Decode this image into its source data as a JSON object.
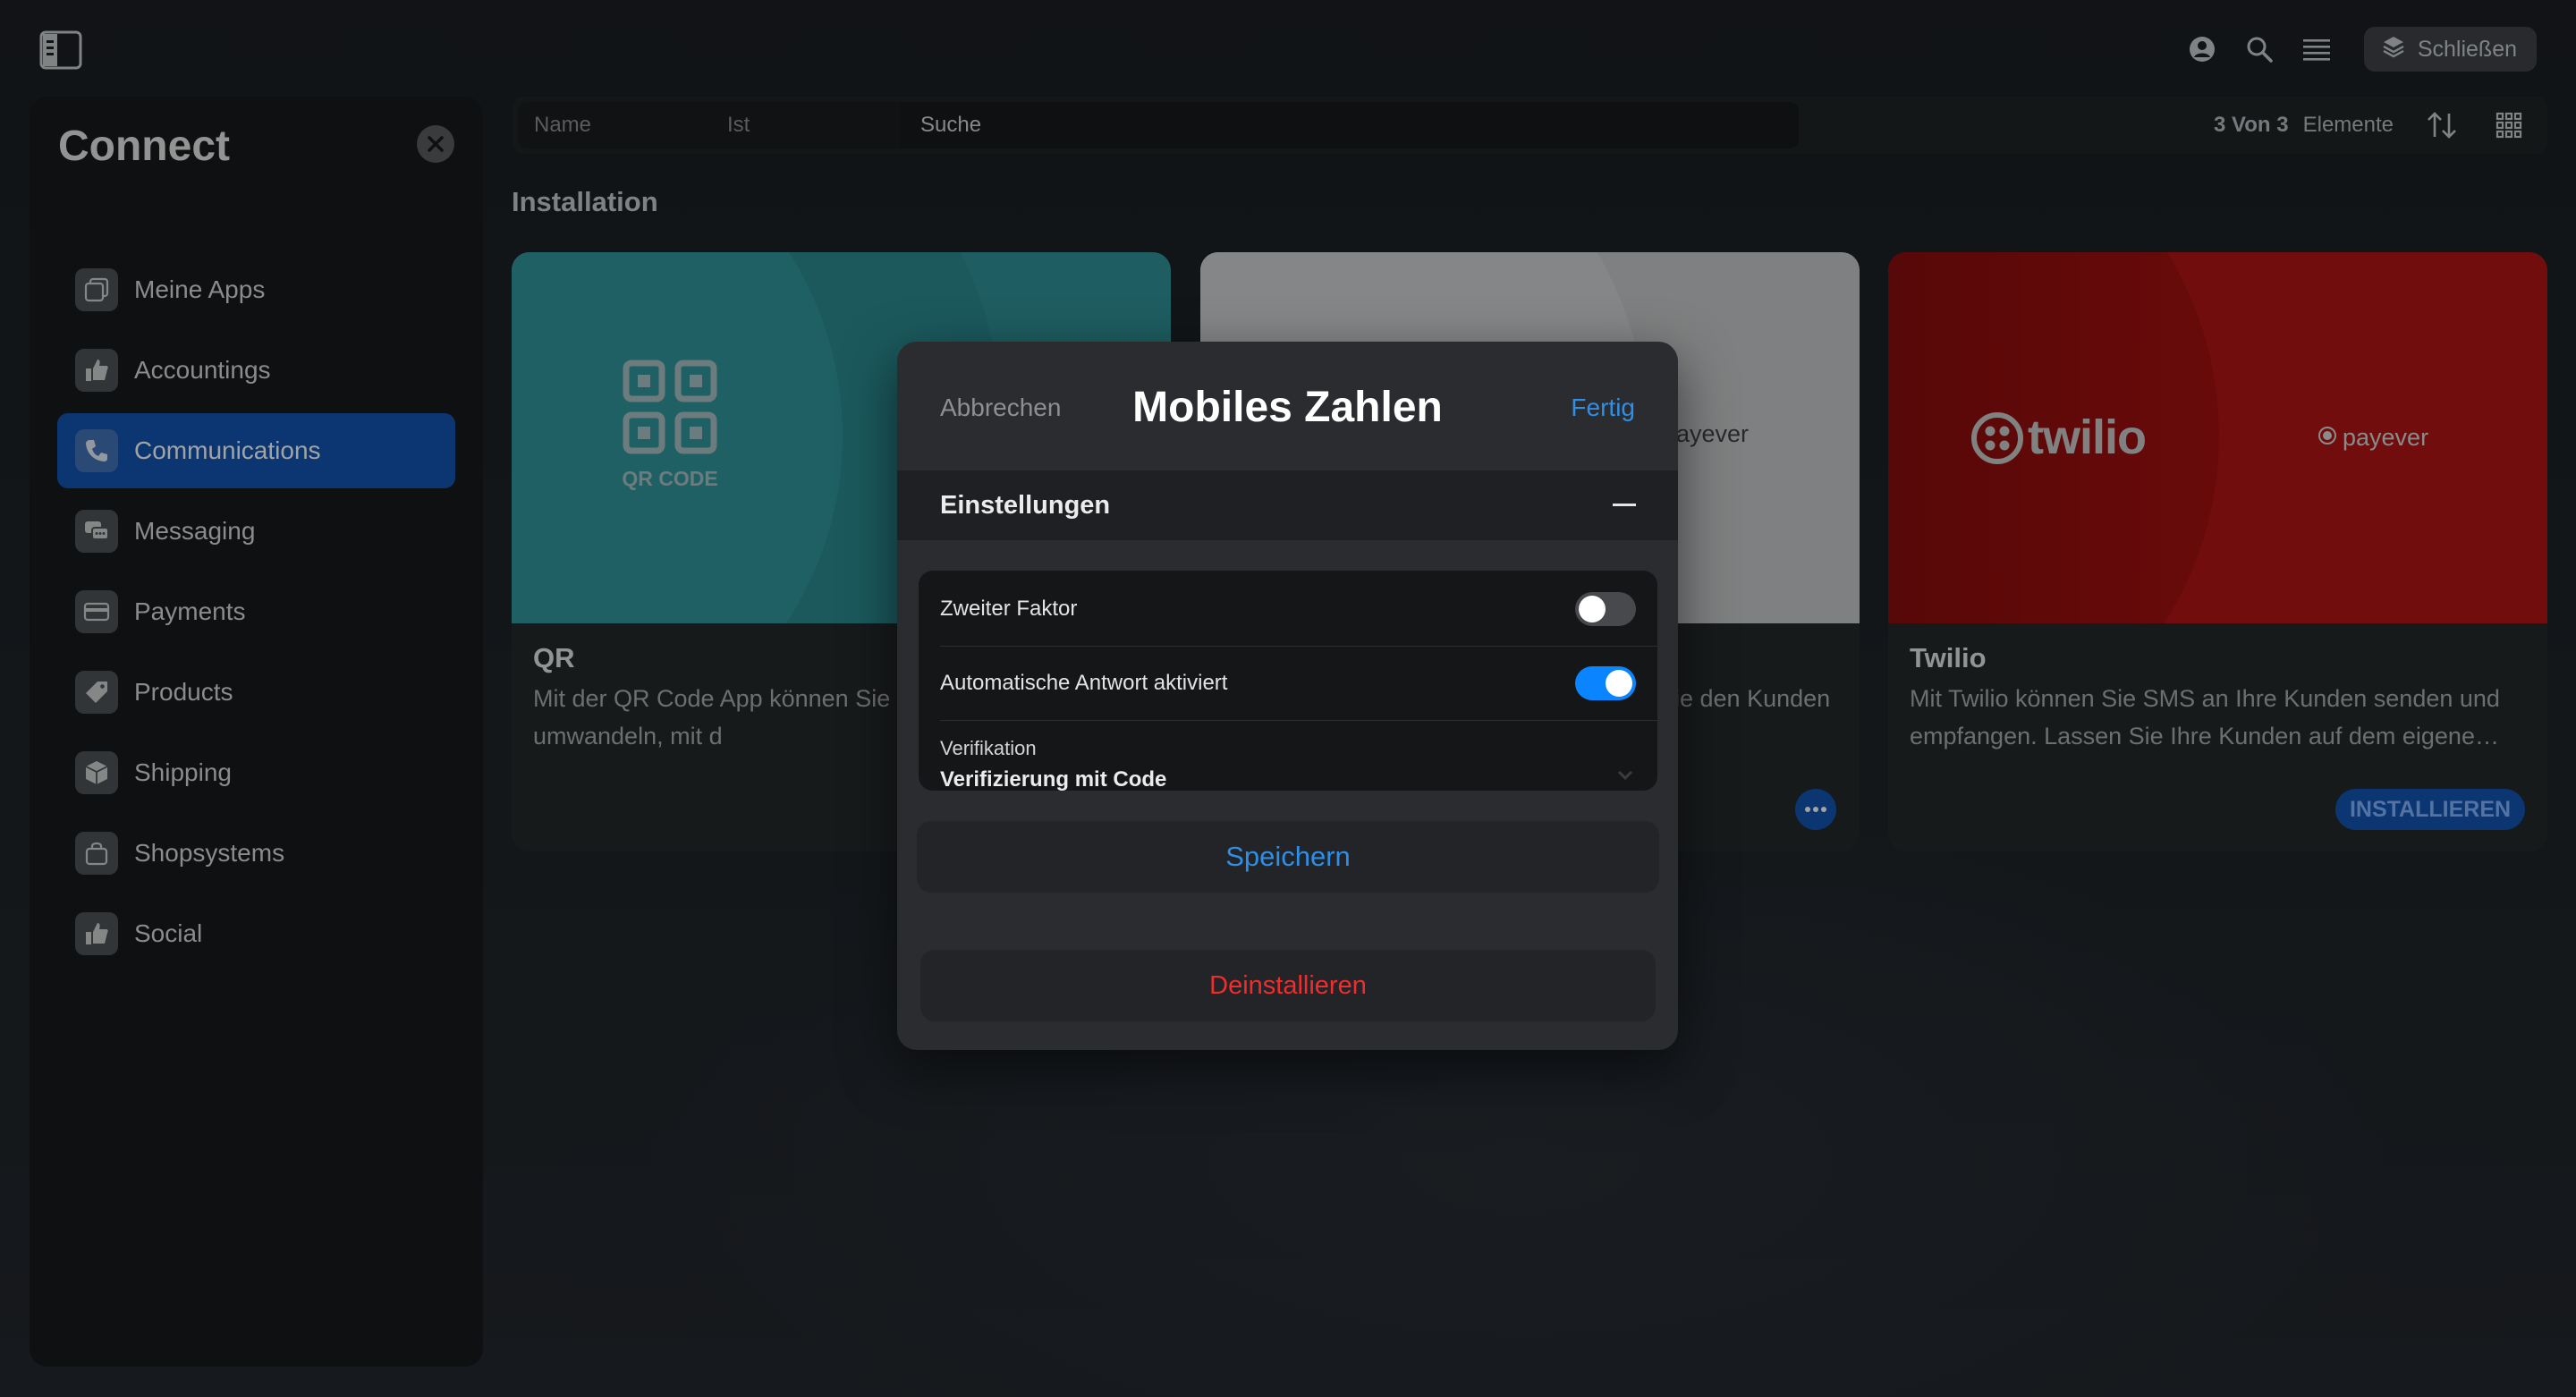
{
  "topbar": {
    "sidebar_toggle_icon": "sidebar-toggle-icon",
    "profile_icon": "profile-icon",
    "search_icon": "search-icon",
    "menu_icon": "menu-icon",
    "close_button_icon": "layers-icon",
    "close_label": "Schließen"
  },
  "sidebar": {
    "title": "Connect",
    "close_icon": "close-icon",
    "items": [
      {
        "label": "Meine Apps",
        "icon": "apps-icon",
        "active": false
      },
      {
        "label": "Accountings",
        "icon": "thumbs-up-icon",
        "active": false
      },
      {
        "label": "Communications",
        "icon": "phone-icon",
        "active": true
      },
      {
        "label": "Messaging",
        "icon": "chat-icon",
        "active": false
      },
      {
        "label": "Payments",
        "icon": "card-icon",
        "active": false
      },
      {
        "label": "Products",
        "icon": "tag-icon",
        "active": false
      },
      {
        "label": "Shipping",
        "icon": "box-icon",
        "active": false
      },
      {
        "label": "Shopsystems",
        "icon": "bag-icon",
        "active": false
      },
      {
        "label": "Social",
        "icon": "thumbs-up-icon",
        "active": false
      }
    ]
  },
  "toolbar": {
    "filter_field": "Name",
    "filter_operator": "Ist",
    "filter_value": "Suche",
    "count": "3 Von 3",
    "count_label": "Elemente",
    "sort_icon": "sort-icon",
    "grid_icon": "grid-icon"
  },
  "main": {
    "section_title": "Installation",
    "cards": [
      {
        "title": "QR",
        "logo_text": "QR CODE",
        "description": "Mit der QR Code App können Sie einen QR Code umwandeln, mit d",
        "accent": "#2a8f95"
      },
      {
        "title": "",
        "logo_text": "ayever",
        "description": "ie den Kunden",
        "accent": "#c6c7c9"
      },
      {
        "title": "Twilio",
        "logo_text": "twilio",
        "brand_text": "payever",
        "description": "Mit Twilio können Sie SMS an Ihre Kunden senden und empfangen. Lassen Sie Ihre Kunden auf dem eigene…",
        "install_label": "INSTALLIEREN",
        "accent": "#b00d0d"
      }
    ]
  },
  "modal": {
    "cancel_label": "Abbrechen",
    "title": "Mobiles Zahlen",
    "done_label": "Fertig",
    "section_title": "Einstellungen",
    "settings": [
      {
        "label": "Zweiter Faktor",
        "enabled": false
      },
      {
        "label": "Automatische Antwort aktiviert",
        "enabled": true
      }
    ],
    "verification_label": "Verifikation",
    "verification_value": "Verifizierung mit Code",
    "save_label": "Speichern",
    "uninstall_label": "Deinstallieren"
  },
  "colors": {
    "accent_blue": "#0a84ff",
    "active_nav": "#0d4fae",
    "danger": "#f02d2d",
    "link": "#2f8fe6"
  }
}
